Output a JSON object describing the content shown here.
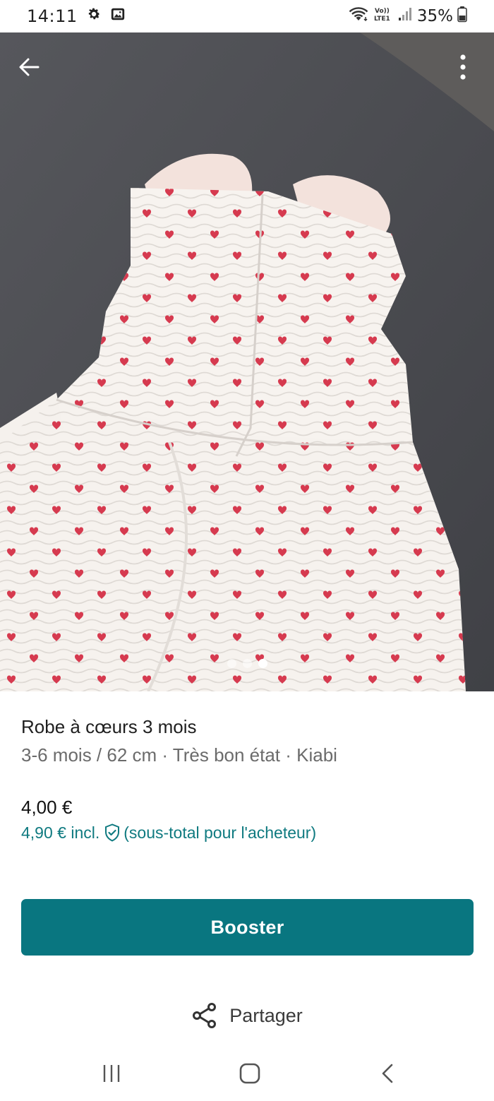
{
  "status_bar": {
    "time": "14:11",
    "battery": "35%",
    "icons": [
      "gear-icon",
      "gallery-icon",
      "wifi-icon",
      "volte-lte-icon",
      "signal-icon",
      "battery-icon"
    ],
    "volte_label": "Vo)) LTE1"
  },
  "photo": {
    "pager_count": 3,
    "active_index": 2,
    "icons": [
      "back-arrow-icon",
      "more-vertical-icon"
    ]
  },
  "item": {
    "title": "Robe à cœurs 3 mois",
    "subtitle": "3-6 mois / 62 cm · Très bon état · Kiabi",
    "price": "4,00 €",
    "price_incl": "4,90 € incl.",
    "price_incl_note": "(sous-total pour l'acheteur)"
  },
  "actions": {
    "booster_label": "Booster",
    "share_label": "Partager"
  },
  "navbar": {
    "icons": [
      "recent-apps-icon",
      "home-icon",
      "nav-back-icon"
    ]
  },
  "colors": {
    "accent": "#097680",
    "link": "#0f7a80",
    "heart": "#d63a4f"
  }
}
